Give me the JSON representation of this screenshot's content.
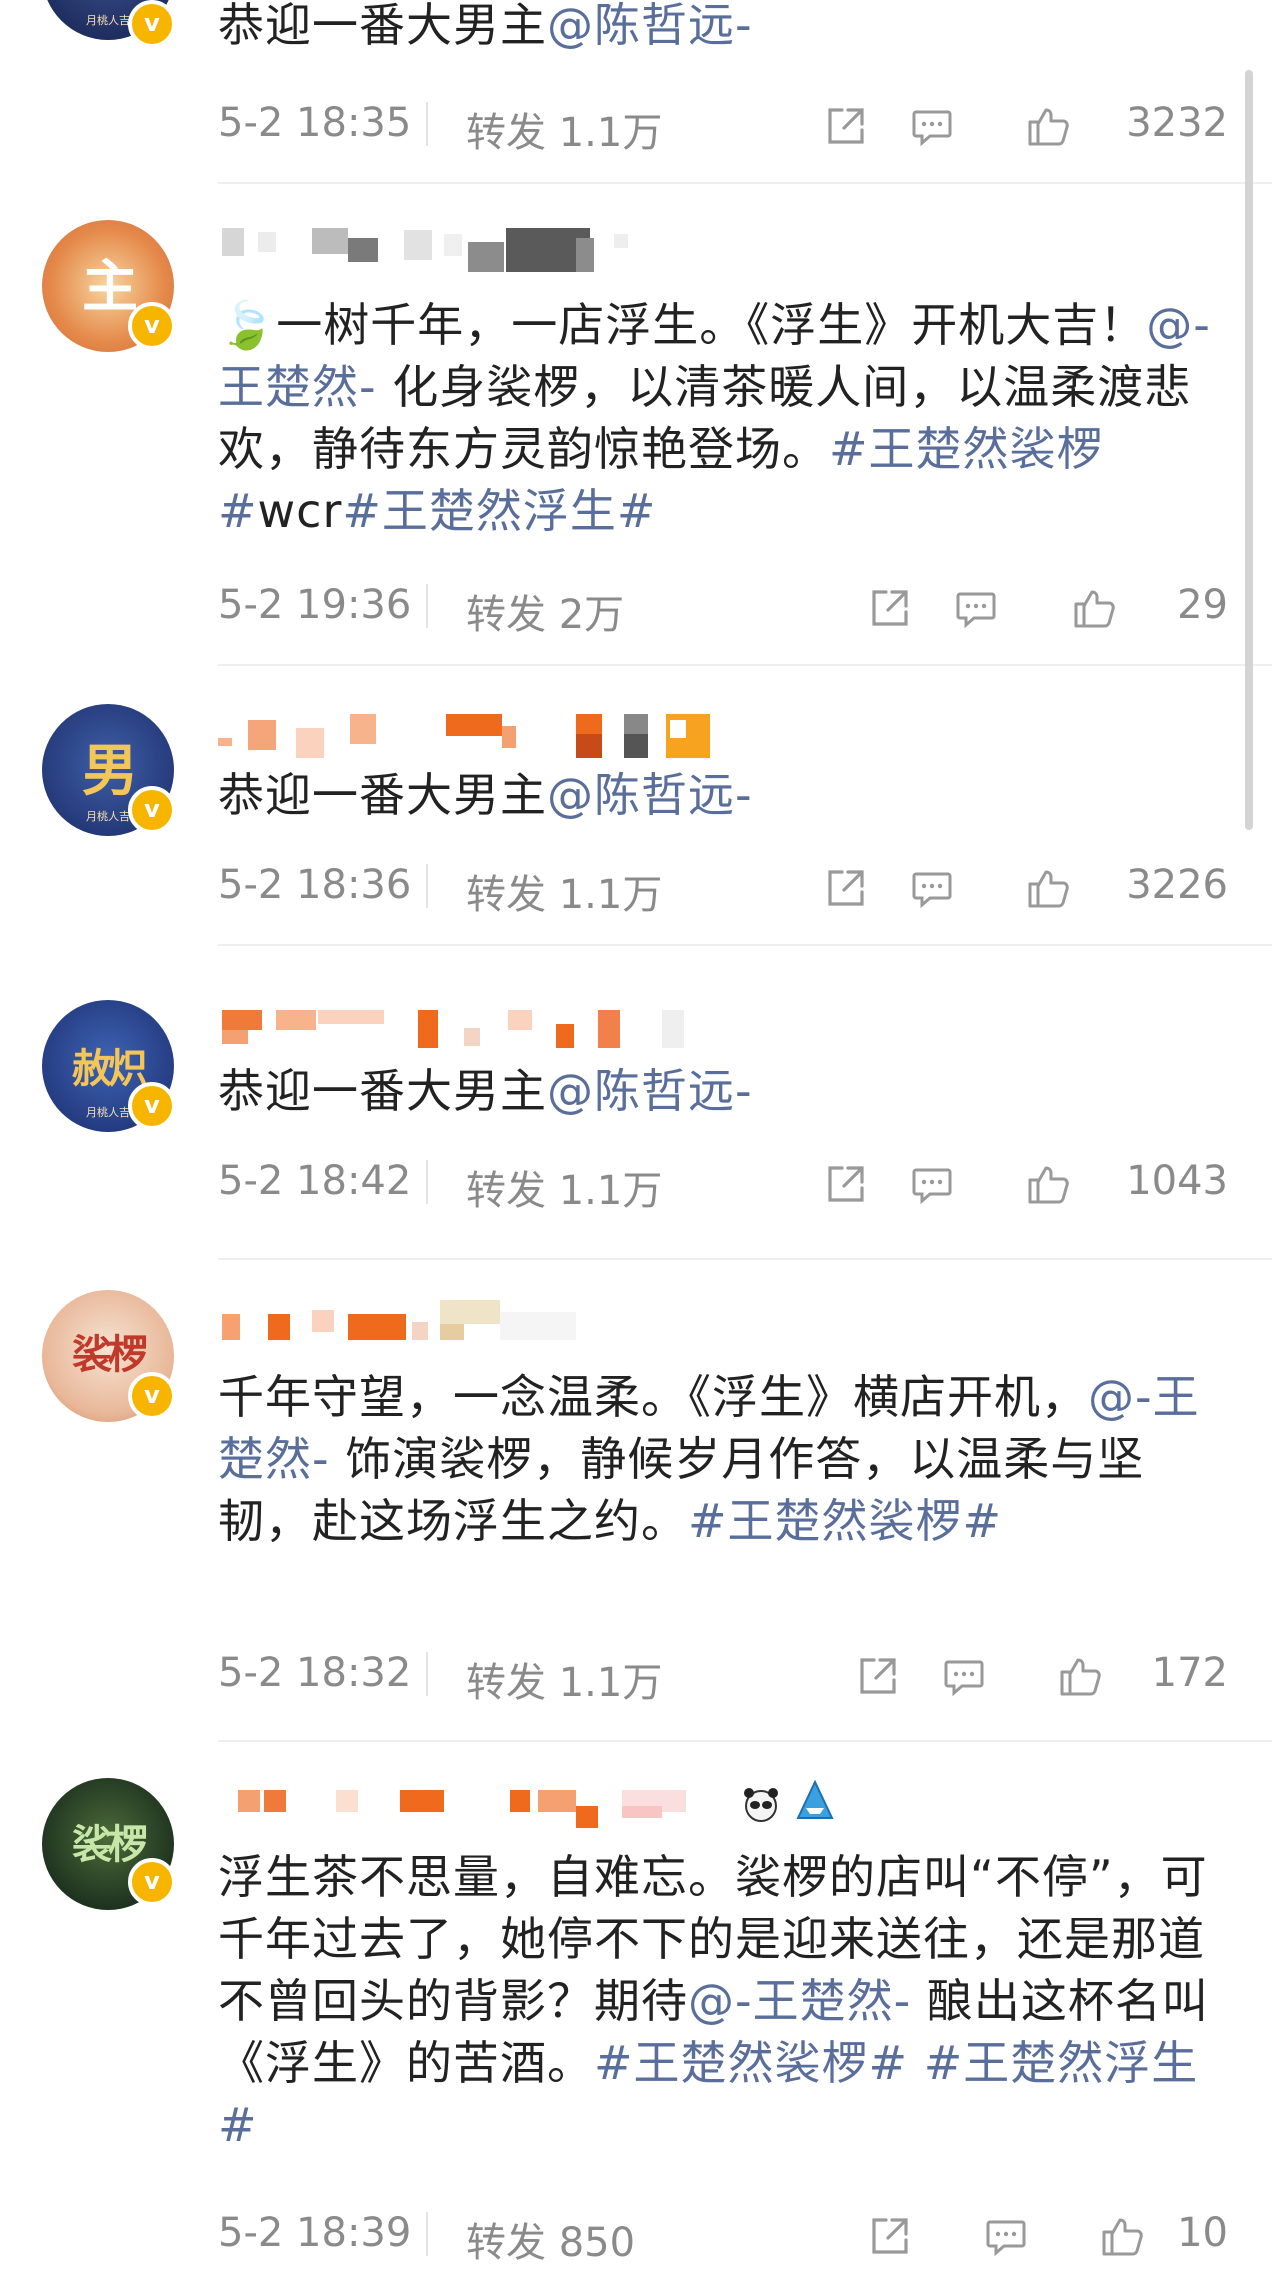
{
  "posts": [
    {
      "avatar_text": "",
      "content": [
        {
          "t": "恭迎一番大男主"
        },
        {
          "t": "@陈哲远-",
          "link": true
        }
      ],
      "time": "5-2 18:35",
      "forward": "转发 1.1万",
      "likes": "3232"
    },
    {
      "avatar_text": "主",
      "content": [
        {
          "t": "🍃一树千年，一店浮生。《浮生》开机大吉！"
        },
        {
          "t": "@-王楚然-",
          "link": true
        },
        {
          "t": " 化身裟椤，以清茶暖人间，以温柔渡悲欢，静待东方灵韵惊艳登场。"
        },
        {
          "t": "#王楚然裟椤#",
          "link": true
        },
        {
          "t": "wcr"
        },
        {
          "t": "#王楚然浮生#",
          "link": true
        }
      ],
      "time": "5-2 19:36",
      "forward": "转发 2万",
      "likes": "29"
    },
    {
      "avatar_text": "男",
      "content": [
        {
          "t": "恭迎一番大男主"
        },
        {
          "t": "@陈哲远-",
          "link": true
        }
      ],
      "time": "5-2 18:36",
      "forward": "转发 1.1万",
      "likes": "3226"
    },
    {
      "avatar_text": "赦炽",
      "content": [
        {
          "t": "恭迎一番大男主"
        },
        {
          "t": "@陈哲远-",
          "link": true
        }
      ],
      "time": "5-2 18:42",
      "forward": "转发 1.1万",
      "likes": "1043"
    },
    {
      "avatar_text": "裟椤",
      "content": [
        {
          "t": "千年守望，一念温柔。《浮生》横店开机，"
        },
        {
          "t": "@-王楚然-",
          "link": true
        },
        {
          "t": " 饰演裟椤，静候岁月作答，以温柔与坚韧，赴这场浮生之约。"
        },
        {
          "t": "#王楚然裟椤#",
          "link": true
        }
      ],
      "time": "5-2 18:32",
      "forward": "转发 1.1万",
      "likes": "172"
    },
    {
      "avatar_text": "裟椤",
      "content": [
        {
          "t": "浮生茶不思量，自难忘。裟椤的店叫“不停”，可千年过去了，她停不下的是迎来送往，还是那道不曾回头的背影？期待"
        },
        {
          "t": "@-王楚然-",
          "link": true
        },
        {
          "t": " 酿出这杯名叫《浮生》的苦酒。"
        },
        {
          "t": "#王楚然裟椤#",
          "link": true
        },
        {
          "t": " "
        },
        {
          "t": "#王楚然浮生#",
          "link": true
        }
      ],
      "time": "5-2 18:39",
      "forward": "转发 850",
      "likes": "10"
    }
  ],
  "avatar_subtext": "月桃人吉",
  "colors": {
    "link": "#5a6e9b",
    "meta": "#8a8a8a",
    "badge": "#f7b500"
  }
}
